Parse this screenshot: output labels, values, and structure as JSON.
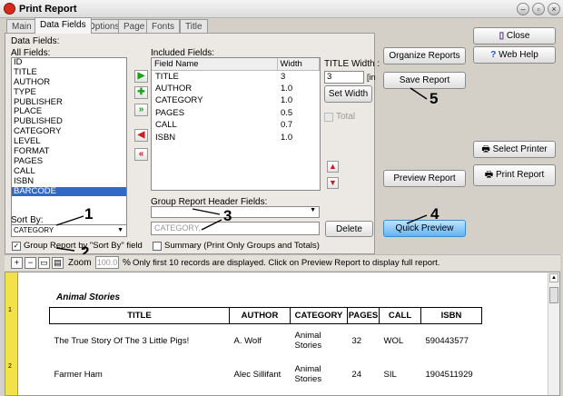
{
  "window": {
    "title": "Print Report"
  },
  "tabs": [
    "Main",
    "Data Fields",
    "Options",
    "Page",
    "Fonts",
    "Title"
  ],
  "data_fields": {
    "group_label": "Data Fields:",
    "all_fields_label": "All Fields:",
    "all_fields": [
      "ID",
      "TITLE",
      "AUTHOR",
      "TYPE",
      "PUBLISHER",
      "PLACE",
      "PUBLISHED",
      "CATEGORY",
      "LEVEL",
      "FORMAT",
      "PAGES",
      "CALL",
      "ISBN",
      "BARCODE"
    ],
    "selected_field": "BARCODE",
    "included_label": "Included Fields:",
    "included_headers": [
      "Field Name",
      "Width"
    ],
    "included": [
      {
        "name": "TITLE",
        "width": "3"
      },
      {
        "name": "AUTHOR",
        "width": "1.0"
      },
      {
        "name": "CATEGORY",
        "width": "1.0"
      },
      {
        "name": "PAGES",
        "width": "0.5"
      },
      {
        "name": "CALL",
        "width": "0.7"
      },
      {
        "name": "ISBN",
        "width": "1.0"
      }
    ],
    "title_width_label": "TITLE Width :",
    "title_width_value": "3",
    "title_width_unit": "[in",
    "set_width": "Set Width",
    "total_label": "Total",
    "sort_by_label": "Sort By:",
    "sort_by_value": "CATEGORY",
    "group_by_sort_label": "Group Report by \"Sort By\" field",
    "group_header_label": "Group Report Header Fields:",
    "group_header_text": "CATEGORY,",
    "delete": "Delete",
    "summary_label": "Summary (Print Only Groups and Totals)"
  },
  "right_buttons": {
    "organize": "Organize Reports",
    "close": "Close",
    "web_help": "Web Help",
    "save": "Save Report",
    "select_printer": "Select Printer",
    "preview": "Preview Report",
    "print": "Print Report",
    "quick_preview": "Quick Preview"
  },
  "annotations": [
    "1",
    "2",
    "3",
    "4",
    "5"
  ],
  "zoom": {
    "label": "Zoom",
    "value": "100.0",
    "unit": "%",
    "note": "Only first 10 records are displayed. Click on Preview Report to display full report."
  },
  "ruler_marks": [
    "1",
    "2"
  ],
  "preview": {
    "group_title": "Animal Stories",
    "headers": [
      "TITLE",
      "AUTHOR",
      "CATEGORY",
      "PAGES",
      "CALL",
      "ISBN"
    ],
    "rows": [
      [
        "The True Story Of The 3 Little Pigs!",
        "A. Wolf",
        "Animal Stories",
        "32",
        "WOL",
        "590443577"
      ],
      [
        "Farmer Ham",
        "Alec  Sillifant",
        "Animal Stories",
        "24",
        "SIL",
        "1904511929"
      ]
    ]
  },
  "colors": {
    "selection": "#3169c6",
    "quick_preview": "#64b4f2",
    "ruler": "#f2e14a"
  }
}
